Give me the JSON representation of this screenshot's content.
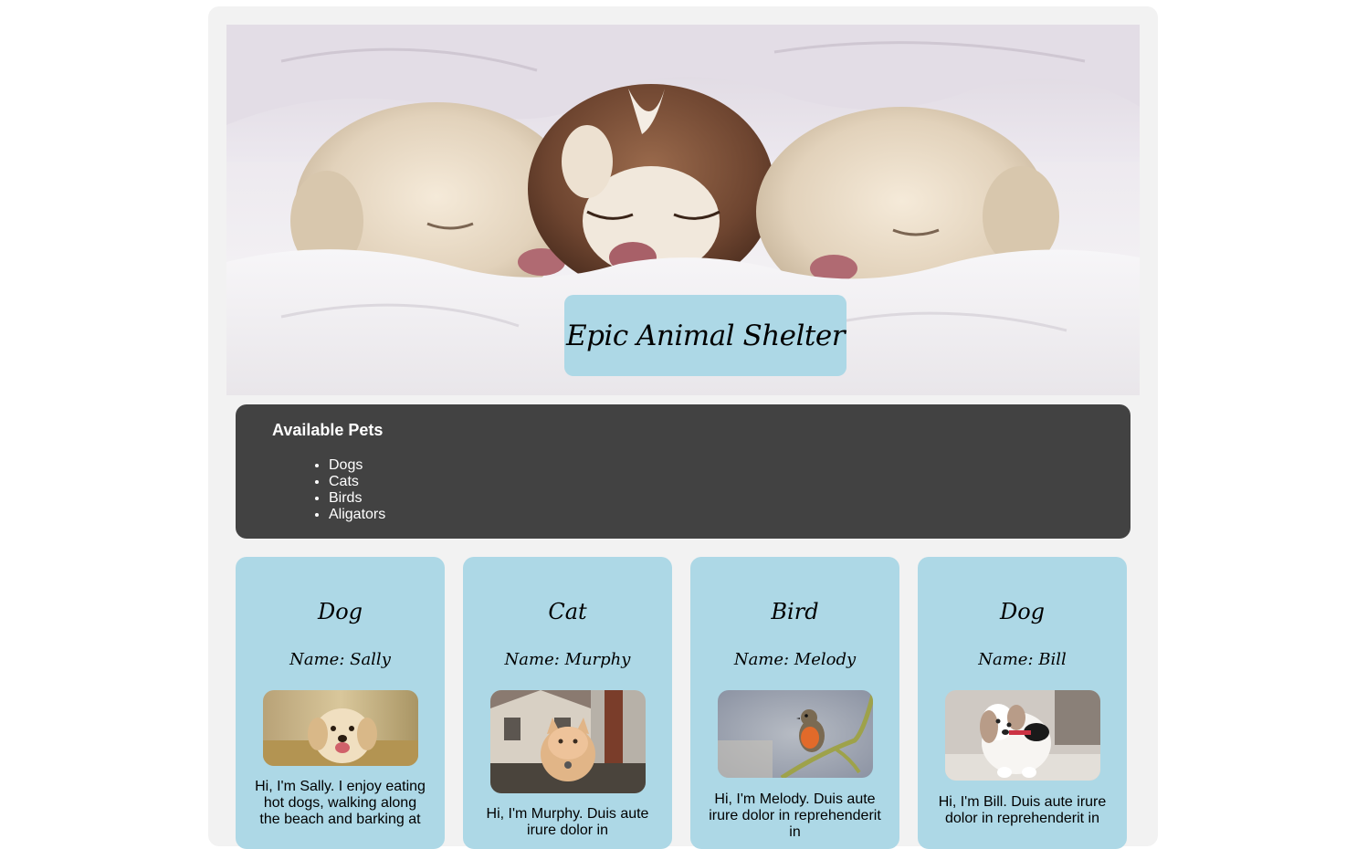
{
  "site": {
    "title": "Epic Animal Shelter"
  },
  "nav": {
    "heading": "Available Pets",
    "items": [
      "Dogs",
      "Cats",
      "Birds",
      "Aligators"
    ]
  },
  "cards": [
    {
      "species": "Dog",
      "name": "Name: Sally",
      "bio": "Hi, I'm Sally. I enjoy eating hot dogs, walking along the beach and barking at",
      "photo_icon": "golden-retriever-puppy-photo"
    },
    {
      "species": "Cat",
      "name": "Name: Murphy",
      "bio": "Hi, I'm Murphy. Duis aute irure dolor in",
      "photo_icon": "orange-cat-photo"
    },
    {
      "species": "Bird",
      "name": "Name: Melody",
      "bio": "Hi, I'm Melody. Duis aute irure dolor in reprehenderit in",
      "photo_icon": "robin-bird-photo"
    },
    {
      "species": "Dog",
      "name": "Name: Bill",
      "bio": "Hi, I'm Bill. Duis aute irure dolor in reprehenderit in",
      "photo_icon": "white-puppy-photo"
    }
  ],
  "colors": {
    "card_bg": "#add8e6",
    "nav_bg": "#424242",
    "page_bg": "#f2f2f2"
  }
}
